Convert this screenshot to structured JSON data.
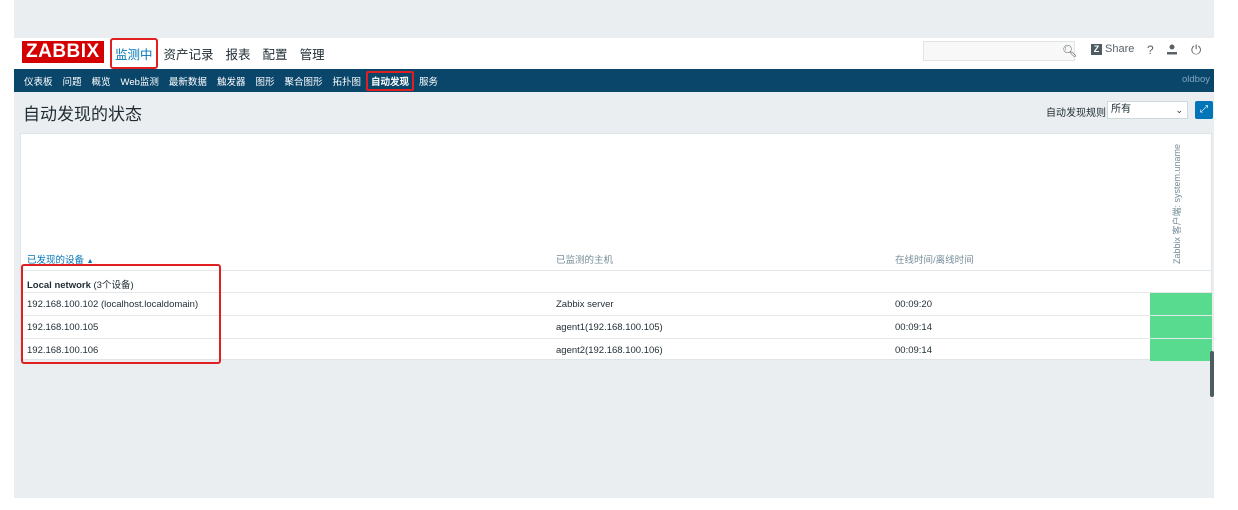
{
  "logo": "ZABBIX",
  "main_menu": [
    "监测中",
    "资产记录",
    "报表",
    "配置",
    "管理"
  ],
  "header_right": {
    "share_label": "Share",
    "share_badge": "Z",
    "help": "?"
  },
  "sub_nav": [
    "仪表板",
    "问题",
    "概览",
    "Web监测",
    "最新数据",
    "触发器",
    "图形",
    "聚合图形",
    "拓扑图",
    "自动发现",
    "服务"
  ],
  "sub_nav_user": "oldboy",
  "page": {
    "title": "自动发现的状态",
    "filter_label": "自动发现规则",
    "filter_value": "所有"
  },
  "table": {
    "col_device": "已发现的设备",
    "sort_arrow": "▲",
    "col_host": "已监测的主机",
    "col_time": "在线时间/离线时间",
    "col_check": "Zabbix 客户端: system.uname",
    "group": {
      "name": "Local network",
      "count": "(3个设备)"
    },
    "rows": [
      {
        "device": "192.168.100.102 (localhost.localdomain)",
        "host": "Zabbix server",
        "time": "00:09:20"
      },
      {
        "device": "192.168.100.105",
        "host": "agent1(192.168.100.105)",
        "time": "00:09:14"
      },
      {
        "device": "192.168.100.106",
        "host": "agent2(192.168.100.106)",
        "time": "00:09:14"
      }
    ]
  },
  "colors": {
    "logo_red": "#d40000",
    "nav_blue": "#0a466a",
    "status_green": "#59db8f",
    "highlight_red": "#e02020"
  }
}
